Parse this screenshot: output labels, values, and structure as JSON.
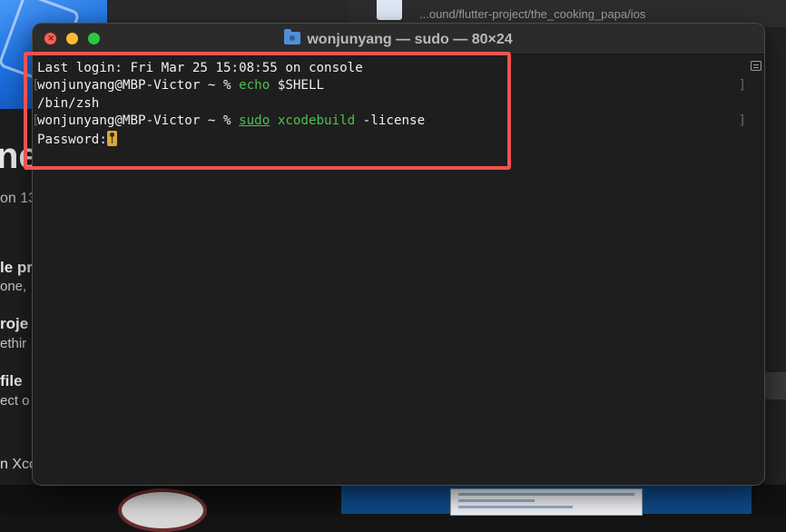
{
  "background": {
    "left_panel": {
      "big_text": "ne",
      "sub_text": "on 13",
      "items": [
        {
          "heading": "le pr",
          "sub": "one,"
        },
        {
          "heading": "roje",
          "sub": "ethir"
        },
        {
          "heading": "file",
          "sub": "ect o"
        }
      ],
      "bottom_text": "n Xco"
    },
    "top_path": "...ound/flutter-project/the_cooking_papa/ios"
  },
  "terminal": {
    "title": "wonjunyang — sudo — 80×24",
    "title_icon": "folder-icon",
    "lines": {
      "last_login": "Last login: Fri Mar 25 15:08:55 on console",
      "prompt1": "wonjunyang@MBP-Victor ~ % ",
      "cmd1_name": "echo",
      "cmd1_args": " $SHELL",
      "output1": "/bin/zsh",
      "prompt2": "wonjunyang@MBP-Victor ~ % ",
      "cmd2_sudo": "sudo",
      "cmd2_name": "xcodebuild",
      "cmd2_args": " -license",
      "password_prompt": "Password:"
    },
    "mark_left": "[",
    "mark_right": "]",
    "highlight_color": "#f0534f",
    "command_color": "#4dc04d",
    "cursor_icon": "key-icon"
  }
}
